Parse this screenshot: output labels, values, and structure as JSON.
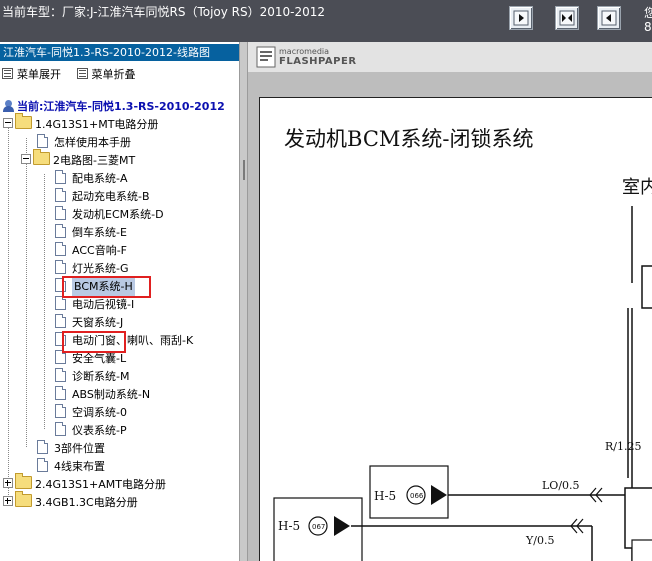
{
  "header": {
    "title": "当前车型：厂家:J-江淮汽车同悦RS（Tojoy RS）2010-2012",
    "cut_text": "您8"
  },
  "left_panel": {
    "model_name": "江淮汽车-同悦1.3-RS-2010-2012-线路图",
    "tools": {
      "expand_label": "菜单展开",
      "collapse_label": "菜单折叠"
    },
    "tree": {
      "root_label": "当前:江淮汽车-同悦1.3-RS-2010-2012",
      "items": [
        {
          "label": "1.4G13S1+MT电路分册"
        },
        {
          "label": "怎样使用本手册"
        },
        {
          "label": "2电路图-三菱MT"
        },
        {
          "label": "配电系统-A"
        },
        {
          "label": "起动充电系统-B"
        },
        {
          "label": "发动机ECM系统-D"
        },
        {
          "label": "倒车系统-E"
        },
        {
          "label": "ACC音响-F"
        },
        {
          "label": "灯光系统-G"
        },
        {
          "label": "BCM系统-H"
        },
        {
          "label": "电动后视镜-I"
        },
        {
          "label": "天窗系统-J"
        },
        {
          "label": "电动门窗、喇叭、雨刮-K"
        },
        {
          "label": "安全气囊-L"
        },
        {
          "label": "诊断系统-M"
        },
        {
          "label": "ABS制动系统-N"
        },
        {
          "label": "空调系统-0"
        },
        {
          "label": "仪表系统-P"
        },
        {
          "label": "3部件位置"
        },
        {
          "label": "4线束布置"
        },
        {
          "label": "2.4G13S1+AMT电路分册"
        },
        {
          "label": "3.4GB1.3C电路分册"
        }
      ]
    }
  },
  "viewer": {
    "brand_small": "macromedia",
    "brand_name": "FLASHPAPER",
    "page_title": "发动机BCM系统-闭锁系统",
    "diagram_labels": {
      "room": "室内",
      "wire1": "R/1.25",
      "wire2": "LO/0.5",
      "wire3": "Y/0.5",
      "conn1": "H-5",
      "conn1_num": "066",
      "conn2": "H-5",
      "conn2_num": "067"
    }
  },
  "colors": {
    "header_bg": "#4b4d55",
    "model_bar": "#06619f",
    "highlight_box": "#e02020",
    "selected_bg": "#b9c9e3"
  }
}
